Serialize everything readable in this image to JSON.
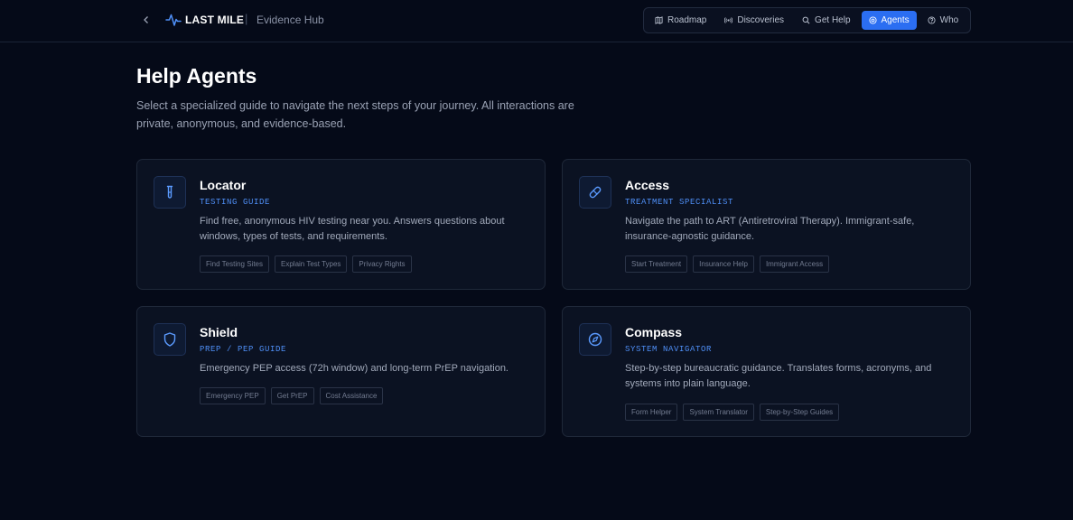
{
  "header": {
    "brand": "LAST MILE",
    "separator": "|",
    "subtitle": "Evidence Hub",
    "nav": [
      {
        "label": "Roadmap",
        "icon": "map-icon",
        "active": false
      },
      {
        "label": "Discoveries",
        "icon": "radio-icon",
        "active": false
      },
      {
        "label": "Get Help",
        "icon": "search-icon",
        "active": false
      },
      {
        "label": "Agents",
        "icon": "agents-icon",
        "active": true
      },
      {
        "label": "Who",
        "icon": "help-circle-icon",
        "active": false
      }
    ]
  },
  "page": {
    "title": "Help Agents",
    "description": "Select a specialized guide to navigate the next steps of your journey. All interactions are private, anonymous, and evidence-based."
  },
  "agents": [
    {
      "name": "Locator",
      "subtitle": "TESTING GUIDE",
      "icon": "test-tube-icon",
      "description": "Find free, anonymous HIV testing near you. Answers questions about windows, types of tests, and requirements.",
      "tags": [
        "Find Testing Sites",
        "Explain Test Types",
        "Privacy Rights"
      ]
    },
    {
      "name": "Access",
      "subtitle": "TREATMENT SPECIALIST",
      "icon": "pill-icon",
      "description": "Navigate the path to ART (Antiretroviral Therapy). Immigrant-safe, insurance-agnostic guidance.",
      "tags": [
        "Start Treatment",
        "Insurance Help",
        "Immigrant Access"
      ]
    },
    {
      "name": "Shield",
      "subtitle": "PREP / PEP GUIDE",
      "icon": "shield-icon",
      "description": "Emergency PEP access (72h window) and long-term PrEP navigation.",
      "tags": [
        "Emergency PEP",
        "Get PrEP",
        "Cost Assistance"
      ]
    },
    {
      "name": "Compass",
      "subtitle": "SYSTEM NAVIGATOR",
      "icon": "compass-icon",
      "description": "Step-by-step bureaucratic guidance. Translates forms, acronyms, and systems into plain language.",
      "tags": [
        "Form Helper",
        "System Translator",
        "Step-by-Step Guides"
      ]
    }
  ],
  "colors": {
    "background": "#050a18",
    "accent": "#2b6ef2",
    "subtitle_accent": "#4f8ff7",
    "card": "#0b1222"
  }
}
